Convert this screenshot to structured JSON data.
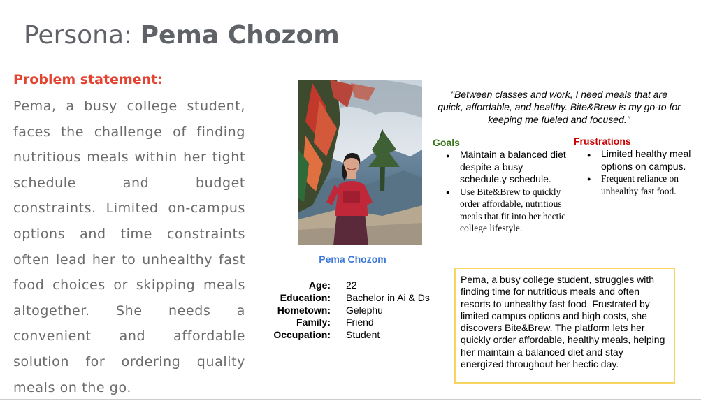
{
  "title": {
    "prefix": "Persona: ",
    "name": "Pema Chozom"
  },
  "problem": {
    "label": "Problem statement:",
    "text": "Pema, a busy college student, faces the challenge of finding nutritious meals within her tight schedule and budget constraints. Limited on-campus options and time constraints often lead her to unhealthy fast food choices or skipping meals altogether. She needs a convenient and affordable solution for ordering quality meals on the go."
  },
  "persona": {
    "caption": "Pema Chozom",
    "labels": [
      "Age:",
      "Education:",
      "Hometown:",
      "Family:",
      "Occupation:"
    ],
    "values": [
      "22",
      "Bachelor in Ai & Ds",
      "Gelephu",
      "Friend",
      "Student"
    ]
  },
  "quote": "\"Between classes and work, I need meals that are quick, affordable, and healthy. Bite&Brew is my go-to for keeping me fueled and focused.\"",
  "goals": {
    "heading": "Goals",
    "items": [
      "Maintain a balanced diet despite a busy schedule.y schedule.",
      "Use Bite&Brew to quickly order affordable, nutritious meals that fit into her hectic college lifestyle."
    ]
  },
  "frustrations": {
    "heading": "Frustrations",
    "items": [
      "Limited healthy meal options on campus.",
      "Frequent reliance on unhealthy fast food."
    ]
  },
  "summary": "Pema, a busy college student, struggles with finding time for nutritious meals and often resorts to unhealthy fast food. Frustrated by limited campus options and high costs, she discovers Bite&Brew. The platform lets her quickly order affordable, healthy meals, helping her maintain a balanced diet and stay energized throughout her hectic day.",
  "colors": {
    "title": "#5f6368",
    "problem_label": "#e24431",
    "body_text": "#6b6b6b",
    "caption": "#3c78d8",
    "goals": "#38761d",
    "frustrations": "#cc0000",
    "summary_border": "#f7d560"
  }
}
